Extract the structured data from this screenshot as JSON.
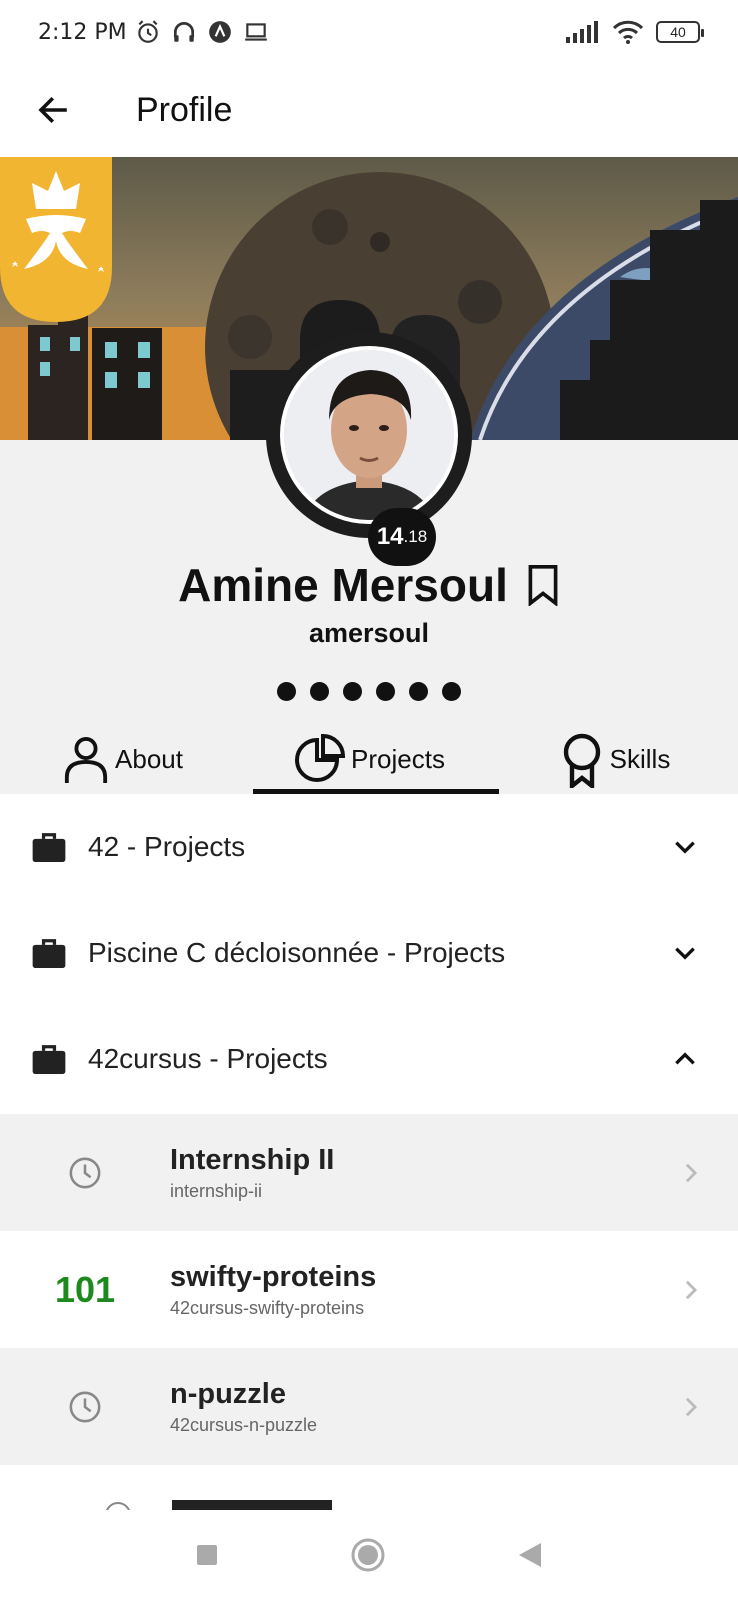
{
  "status_bar": {
    "time": "2:12 PM",
    "battery": "40"
  },
  "app_bar": {
    "title": "Profile"
  },
  "profile": {
    "level_int": "14",
    "level_dec": ".18",
    "name": "Amine Mersoul",
    "login": "amersoul"
  },
  "tabs": [
    {
      "label": "About",
      "icon": "person-icon"
    },
    {
      "label": "Projects",
      "icon": "pie-chart-icon",
      "active": true
    },
    {
      "label": "Skills",
      "icon": "badge-icon"
    }
  ],
  "cursus": [
    {
      "label": "42 - Projects",
      "expanded": false
    },
    {
      "label": "Piscine C décloisonnée - Projects",
      "expanded": false
    },
    {
      "label": "42cursus - Projects",
      "expanded": true
    }
  ],
  "projects": [
    {
      "name": "Internship II",
      "slug": "internship-ii",
      "status": "in-progress"
    },
    {
      "name": "swifty-proteins",
      "slug": "42cursus-swifty-proteins",
      "mark": "101"
    },
    {
      "name": "n-puzzle",
      "slug": "42cursus-n-puzzle",
      "status": "in-progress"
    }
  ],
  "colors": {
    "mark_green": "#1e8a1e",
    "badge_yellow": "#f2b531",
    "tab_indicator": "#111111"
  }
}
